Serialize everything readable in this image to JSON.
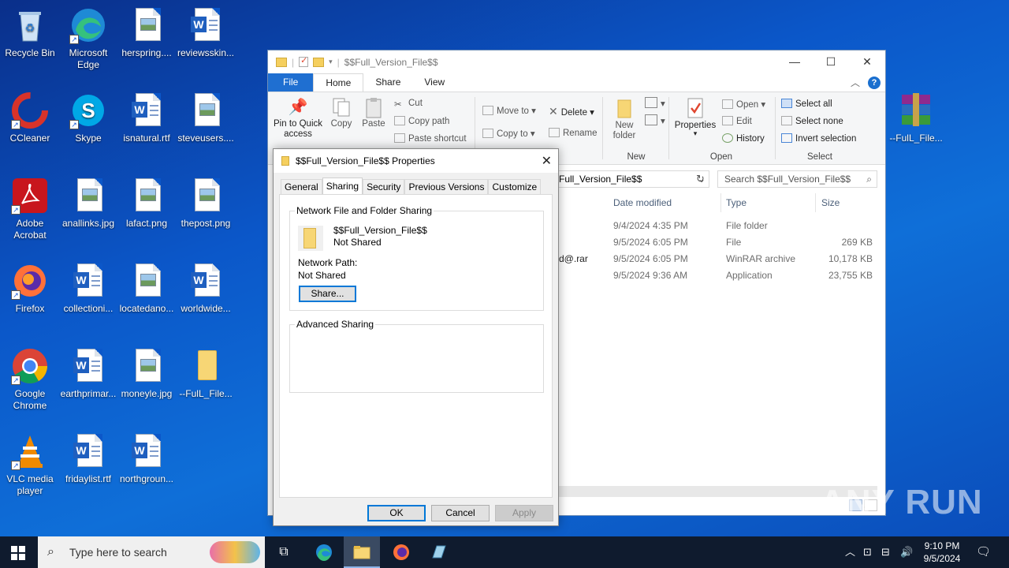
{
  "desktop": {
    "icons": [
      {
        "label": "Recycle Bin"
      },
      {
        "label": "Microsoft Edge"
      },
      {
        "label": "herspring...."
      },
      {
        "label": "reviewsskin..."
      },
      {
        "label": "CCleaner"
      },
      {
        "label": "Skype"
      },
      {
        "label": "isnatural.rtf"
      },
      {
        "label": "steveusers...."
      },
      {
        "label": "Adobe Acrobat"
      },
      {
        "label": "anallinks.jpg"
      },
      {
        "label": "lafact.png"
      },
      {
        "label": "thepost.png"
      },
      {
        "label": "Firefox"
      },
      {
        "label": "collectioni..."
      },
      {
        "label": "locatedano..."
      },
      {
        "label": "worldwide..."
      },
      {
        "label": "Google Chrome"
      },
      {
        "label": "earthprimar..."
      },
      {
        "label": "moneyle.jpg"
      },
      {
        "label": "--FulL_File..."
      },
      {
        "label": "VLC media player"
      },
      {
        "label": "fridaylist.rtf"
      },
      {
        "label": "northgroun..."
      },
      {
        "label": "--FulL_File..."
      }
    ]
  },
  "explorer": {
    "title": "$$Full_Version_File$$",
    "tabs": [
      "File",
      "Home",
      "Share",
      "View"
    ],
    "ribbon": {
      "pin": "Pin to Quick access",
      "copy": "Copy",
      "paste": "Paste",
      "cut": "Cut",
      "copy_path": "Copy path",
      "paste_shortcut": "Paste shortcut",
      "move_to": "Move to",
      "copy_to": "Copy to",
      "delete": "Delete",
      "rename": "Rename",
      "new_folder": "New folder",
      "new_group": "New",
      "properties": "Properties",
      "open": "Open",
      "edit": "Edit",
      "history": "History",
      "open_group": "Open",
      "select_all": "Select all",
      "select_none": "Select none",
      "invert_selection": "Invert selection",
      "select_group": "Select"
    },
    "address": "Full_Version_File$$",
    "search_placeholder": "Search $$Full_Version_File$$",
    "columns": {
      "date": "Date modified",
      "type": "Type",
      "size": "Size"
    },
    "rows": [
      {
        "name": "",
        "date": "9/4/2024 4:35 PM",
        "type": "File folder",
        "size": ""
      },
      {
        "name": "",
        "date": "9/5/2024 6:05 PM",
        "type": "File",
        "size": "269 KB"
      },
      {
        "name": "d@.rar",
        "date": "9/5/2024 6:05 PM",
        "type": "WinRAR archive",
        "size": "10,178 KB"
      },
      {
        "name": "",
        "date": "9/5/2024 9:36 AM",
        "type": "Application",
        "size": "23,755 KB"
      }
    ]
  },
  "dialog": {
    "title": "$$Full_Version_File$$ Properties",
    "tabs": [
      "General",
      "Sharing",
      "Security",
      "Previous Versions",
      "Customize"
    ],
    "network_group": "Network File and Folder Sharing",
    "folder_name": "$$Full_Version_File$$",
    "folder_state": "Not Shared",
    "network_path_label": "Network Path:",
    "network_path_value": "Not Shared",
    "share_button": "Share...",
    "advanced_group": "Advanced Sharing",
    "ok": "OK",
    "cancel": "Cancel",
    "apply": "Apply"
  },
  "taskbar": {
    "search_placeholder": "Type here to search",
    "time": "9:10 PM",
    "date": "9/5/2024"
  },
  "watermark": "ANY RUN",
  "colors": {
    "accent": "#0078d7",
    "desktop": "#0b57c9",
    "taskbar": "#0f1b2e"
  }
}
